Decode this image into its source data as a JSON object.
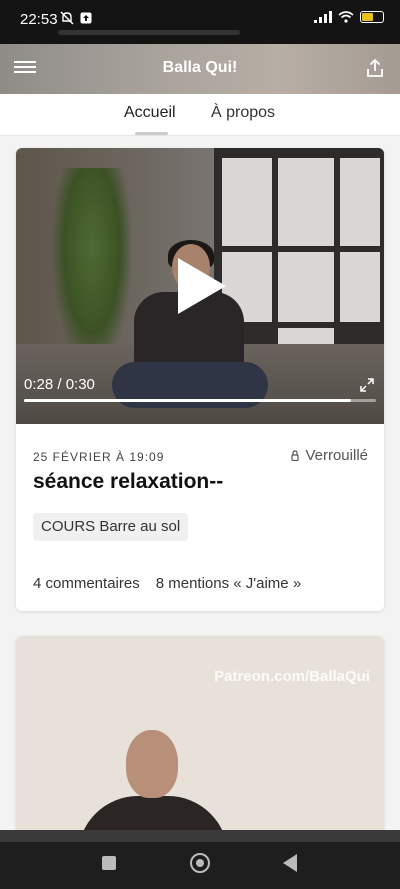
{
  "status_bar": {
    "time": "22:53",
    "icons": [
      "bell-off-icon",
      "upload-notification-icon",
      "signal-icon",
      "wifi-icon",
      "battery-icon"
    ],
    "battery_level": 0.6
  },
  "header": {
    "title": "Balla Qui!",
    "left_icon": "menu-icon",
    "right_icon": "share-icon"
  },
  "tabs": [
    {
      "label": "Accueil",
      "active": true
    },
    {
      "label": "À propos",
      "active": false
    }
  ],
  "posts": [
    {
      "video": {
        "current_time": "0:28 / 0:30",
        "progress": 0.93
      },
      "date": "25 FÉVRIER À 19:09",
      "lock_label": "Verrouillé",
      "title": "séance relaxation--",
      "tag": "COURS Barre au sol",
      "comments": "4 commentaires",
      "likes": "8 mentions « J'aime »"
    },
    {
      "watermark": "Patreon.com/BallaQui"
    }
  ],
  "nav": {
    "recents_icon": "square-icon",
    "home_icon": "circle-home-icon",
    "back_icon": "triangle-back-icon"
  },
  "colors": {
    "header_gradient_start": "#8f8c88",
    "header_gradient_end": "#a49b92",
    "progress_fill": "#ffffff",
    "battery_fill": "#e8c01d"
  }
}
